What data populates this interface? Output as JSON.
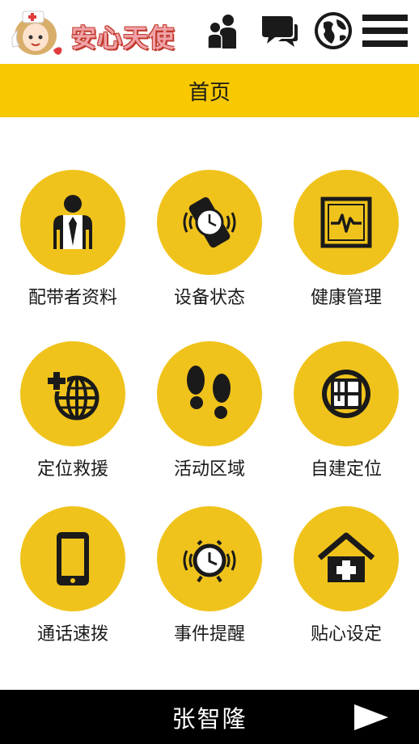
{
  "header": {
    "logo_text": "安心天使",
    "icons": [
      "people-icon",
      "chat-icon",
      "globe-icon",
      "menu-icon"
    ]
  },
  "page_title": "首页",
  "grid": [
    {
      "label": "配带者资料",
      "icon": "person-tie-icon"
    },
    {
      "label": "设备状态",
      "icon": "watch-signal-icon"
    },
    {
      "label": "健康管理",
      "icon": "heartbeat-monitor-icon"
    },
    {
      "label": "定位救援",
      "icon": "globe-cross-icon"
    },
    {
      "label": "活动区域",
      "icon": "footprints-icon"
    },
    {
      "label": "自建定位",
      "icon": "map-location-icon"
    },
    {
      "label": "通话速拨",
      "icon": "phone-icon"
    },
    {
      "label": "事件提醒",
      "icon": "alarm-clock-icon"
    },
    {
      "label": "贴心设定",
      "icon": "home-cross-icon"
    }
  ],
  "footer": {
    "user_name": "张智隆",
    "next_icon": "play-arrow-icon"
  },
  "colors": {
    "accent": "#f8c800",
    "circle": "#f0c31c",
    "footer_bg": "#000000",
    "logo_text": "#f0a2a8"
  }
}
